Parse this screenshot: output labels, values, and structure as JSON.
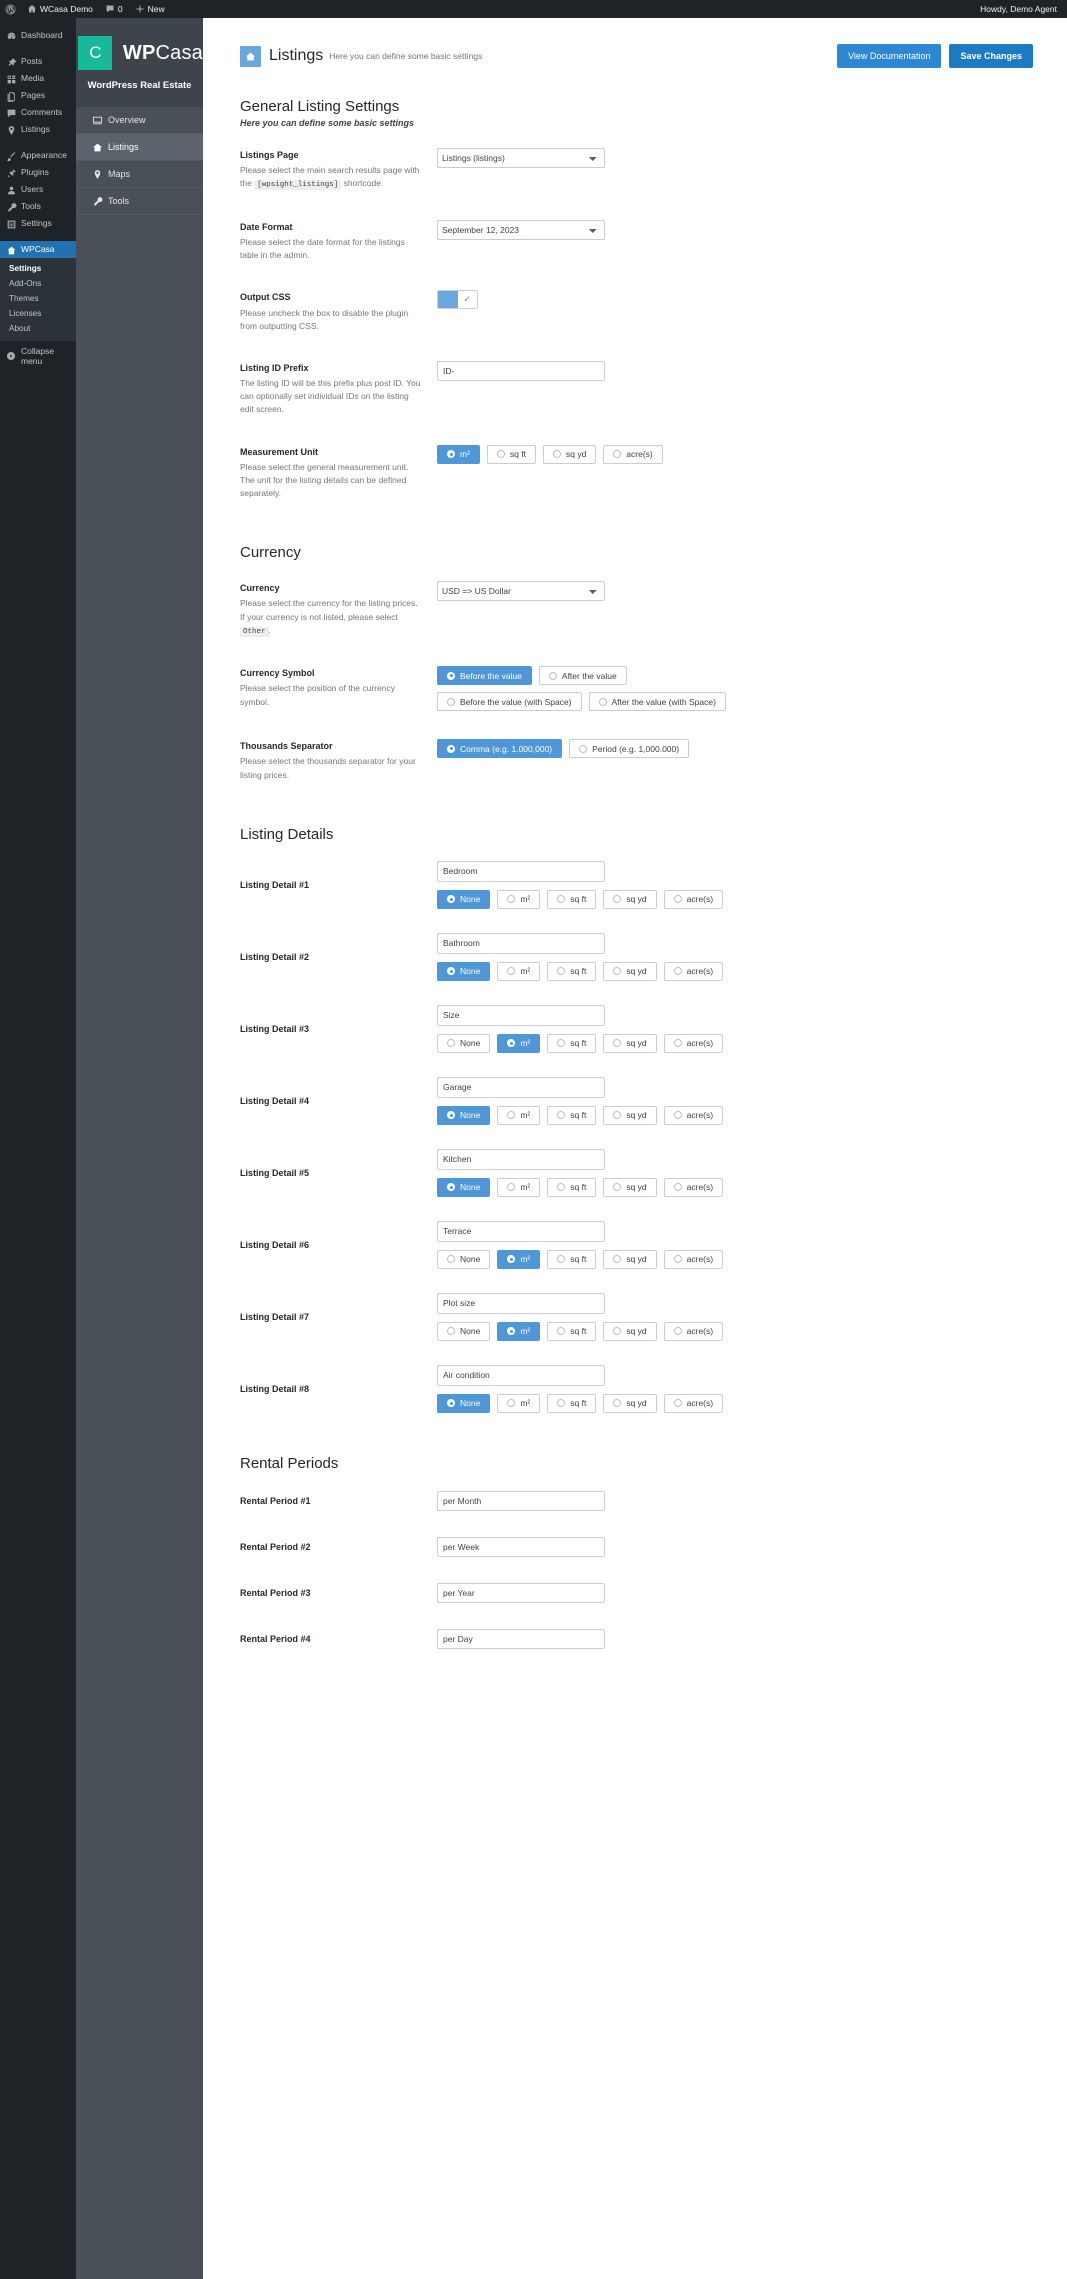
{
  "adminbar": {
    "site_name": "WCasa Demo",
    "comment_count": "0",
    "new_label": "New",
    "howdy": "Howdy, Demo Agent"
  },
  "wp_sidebar": {
    "items": [
      {
        "label": "Dashboard",
        "icon": "dashboard-icon",
        "active": false
      },
      {
        "label": "Posts",
        "icon": "pin-icon",
        "active": false
      },
      {
        "label": "Media",
        "icon": "media-icon",
        "active": false
      },
      {
        "label": "Pages",
        "icon": "pages-icon",
        "active": false
      },
      {
        "label": "Comments",
        "icon": "comments-icon",
        "active": false
      },
      {
        "label": "Listings",
        "icon": "marker-icon",
        "active": false
      },
      {
        "label": "Appearance",
        "icon": "brush-icon",
        "active": false
      },
      {
        "label": "Plugins",
        "icon": "plug-icon",
        "active": false
      },
      {
        "label": "Users",
        "icon": "user-icon",
        "active": false
      },
      {
        "label": "Tools",
        "icon": "wrench-icon",
        "active": false
      },
      {
        "label": "Settings",
        "icon": "settings-icon",
        "active": false
      },
      {
        "label": "WPCasa",
        "icon": "wpcasa-icon",
        "active": true
      }
    ],
    "submenu": [
      {
        "label": "Settings",
        "current": true
      },
      {
        "label": "Add-Ons",
        "current": false
      },
      {
        "label": "Themes",
        "current": false
      },
      {
        "label": "Licenses",
        "current": false
      },
      {
        "label": "About",
        "current": false
      }
    ],
    "collapse_label": "Collapse menu"
  },
  "plugin_nav": {
    "logo_letter": "C",
    "wordmark_bold": "WP",
    "wordmark_light": "Casa",
    "tagline": "WordPress Real Estate",
    "items": [
      {
        "label": "Overview",
        "icon": "screen-icon",
        "active": false
      },
      {
        "label": "Listings",
        "icon": "listings-icon",
        "active": true
      },
      {
        "label": "Maps",
        "icon": "map-pin-icon",
        "active": false
      },
      {
        "label": "Tools",
        "icon": "wrench-icon",
        "active": false
      }
    ]
  },
  "page_header": {
    "title": "Listings",
    "subtitle": "Here you can define some basic settings",
    "doc_button": "View Documentation",
    "save_button": "Save Changes"
  },
  "general": {
    "heading": "General Listing Settings",
    "subheading": "Here you can define some basic settings",
    "listings_page": {
      "title": "Listings Page",
      "desc_before": "Please select the main search results page with the",
      "desc_code": "[wpsight_listings]",
      "desc_after": "shortcode.",
      "value": "Listings (listings)"
    },
    "date_format": {
      "title": "Date Format",
      "desc": "Please select the date format for the listings table in the admin.",
      "value": "September 12, 2023"
    },
    "output_css": {
      "title": "Output CSS",
      "desc": "Please uncheck the box to disable the plugin from outputting CSS.",
      "checked": true,
      "check_glyph": "✓"
    },
    "listing_id_prefix": {
      "title": "Listing ID Prefix",
      "desc": "The listing ID will be this prefix plus post ID. You can optionally set individual IDs on the listing edit screen.",
      "value": "ID-"
    },
    "measurement_unit": {
      "title": "Measurement Unit",
      "desc": "Please select the general measurement unit. The unit for the listing details can be defined separately.",
      "options": [
        "m²",
        "sq ft",
        "sq yd",
        "acre(s)"
      ],
      "selected": "m²"
    }
  },
  "currency": {
    "heading": "Currency",
    "currency_field": {
      "title": "Currency",
      "desc_before": "Please select the currency for the listing prices. If your currency is not listed, please select",
      "desc_code": "Other",
      "desc_after": ".",
      "value": "USD => US Dollar"
    },
    "currency_symbol": {
      "title": "Currency Symbol",
      "desc": "Please select the position of the currency symbol.",
      "options_line1": [
        "Before the value",
        "After the value"
      ],
      "options_line2": [
        "Before the value (with Space)",
        "After the value (with Space)"
      ],
      "selected": "Before the value"
    },
    "thousands_separator": {
      "title": "Thousands Separator",
      "desc": "Please select the thousands separator for your listing prices.",
      "options": [
        "Comma (e.g. 1.000,000)",
        "Period (e.g. 1,000.000)"
      ],
      "selected": "Comma (e.g. 1.000,000)"
    }
  },
  "listing_details": {
    "heading": "Listing Details",
    "unit_options": [
      "None",
      "m²",
      "sq ft",
      "sq yd",
      "acre(s)"
    ],
    "items": [
      {
        "label": "Listing Detail #1",
        "value": "Bedroom",
        "unit": "None"
      },
      {
        "label": "Listing Detail #2",
        "value": "Bathroom",
        "unit": "None"
      },
      {
        "label": "Listing Detail #3",
        "value": "Size",
        "unit": "m²"
      },
      {
        "label": "Listing Detail #4",
        "value": "Garage",
        "unit": "None"
      },
      {
        "label": "Listing Detail #5",
        "value": "Kitchen",
        "unit": "None"
      },
      {
        "label": "Listing Detail #6",
        "value": "Terrace",
        "unit": "m²"
      },
      {
        "label": "Listing Detail #7",
        "value": "Plot size",
        "unit": "m²"
      },
      {
        "label": "Listing Detail #8",
        "value": "Air condition",
        "unit": "None"
      }
    ]
  },
  "rental_periods": {
    "heading": "Rental Periods",
    "items": [
      {
        "label": "Rental Period #1",
        "value": "per Month"
      },
      {
        "label": "Rental Period #2",
        "value": "per Week"
      },
      {
        "label": "Rental Period #3",
        "value": "per Year"
      },
      {
        "label": "Rental Period #4",
        "value": "per Day"
      }
    ]
  },
  "colors": {
    "accent": "#4f97d6",
    "brand_teal": "#17b99a",
    "admin_dark": "#1d2327",
    "panel": "#4a5058"
  }
}
